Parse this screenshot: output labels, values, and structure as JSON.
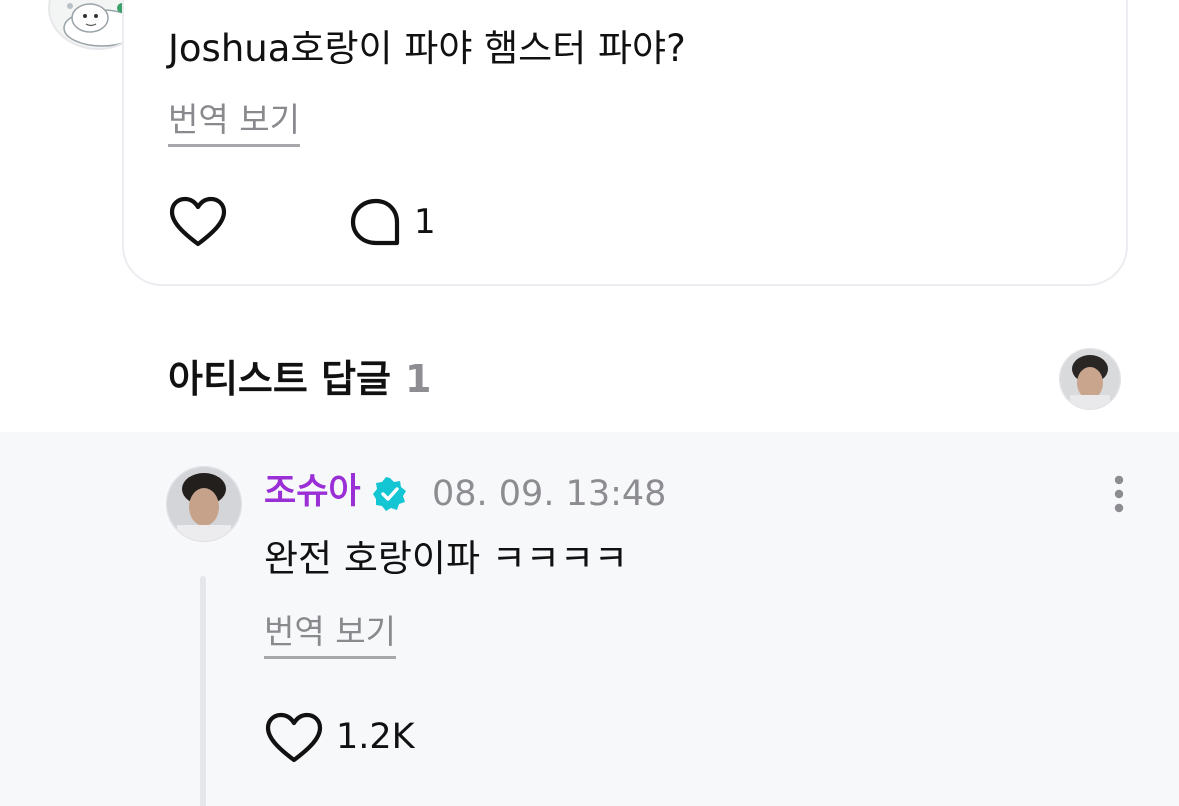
{
  "post": {
    "text": "Joshua호랑이 파야 햄스터 파야?",
    "translate_label": "번역 보기",
    "comment_count": "1",
    "avatar_icon": "seal-character-avatar",
    "like_icon": "heart-outline-icon",
    "comment_icon": "speech-bubble-icon"
  },
  "artist_replies": {
    "title": "아티스트 답글",
    "count": "1"
  },
  "reply": {
    "author": "조슈아",
    "timestamp": "08. 09. 13:48",
    "text": "완전 호랑이파 ㅋㅋㅋㅋ",
    "translate_label": "번역 보기",
    "like_count": "1.2K",
    "badge_color": "#14c6d3",
    "author_color": "#9b2fd6"
  }
}
